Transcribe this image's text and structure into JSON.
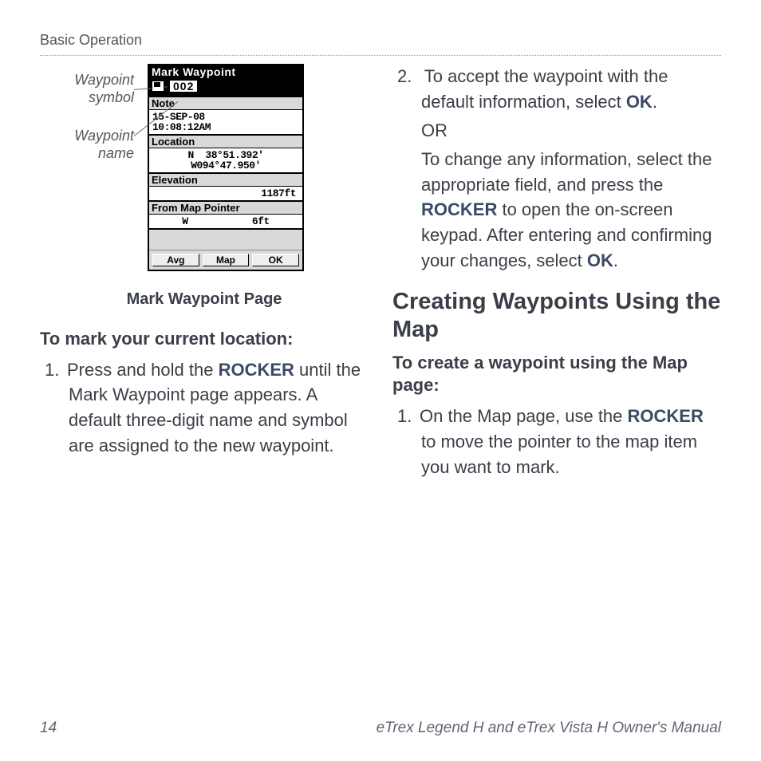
{
  "header": "Basic Operation",
  "callouts": {
    "symbol": "Waypoint symbol",
    "name": "Waypoint name"
  },
  "device": {
    "title": "Mark Waypoint",
    "waypoint_name": "002",
    "note_label": "Note",
    "date_line1": "15-SEP-08",
    "date_line2": "10:08:12AM",
    "location_label": "Location",
    "location_value": "N  38°51.392'\nW094°47.950'",
    "elevation_label": "Elevation",
    "elevation_value": "1187ft",
    "from_pointer_label": "From Map Pointer",
    "from_pointer_value": "W           6ft",
    "buttons": {
      "avg": "Avg",
      "map": "Map",
      "ok": "OK"
    }
  },
  "caption": "Mark Waypoint Page",
  "left": {
    "sub_heading": "To mark your current location:",
    "step1_a": "Press and hold the ",
    "step1_b": "ROCKER",
    "step1_c": " until the Mark Waypoint page appears. A default three-digit name and symbol are assigned to the new waypoint."
  },
  "right": {
    "step2_a": "To accept the waypoint with the default information, select ",
    "step2_ok1": "OK",
    "step2_b": ".",
    "or": "OR",
    "step2_c": "To change any information, select the appropriate field, and press the ",
    "step2_rocker": "ROCKER",
    "step2_d": " to open the on-screen keypad. After entering and confirming your changes, select ",
    "step2_ok2": "OK",
    "step2_e": ".",
    "section_heading": "Creating Waypoints Using the Map",
    "sub_heading": "To create a waypoint using the Map page:",
    "mstep1_a": "On the Map page, use the ",
    "mstep1_b": "ROCKER",
    "mstep1_c": " to move the pointer to the map item you want to mark."
  },
  "footer": {
    "page": "14",
    "title": "eTrex Legend H and eTrex Vista H Owner's Manual"
  }
}
